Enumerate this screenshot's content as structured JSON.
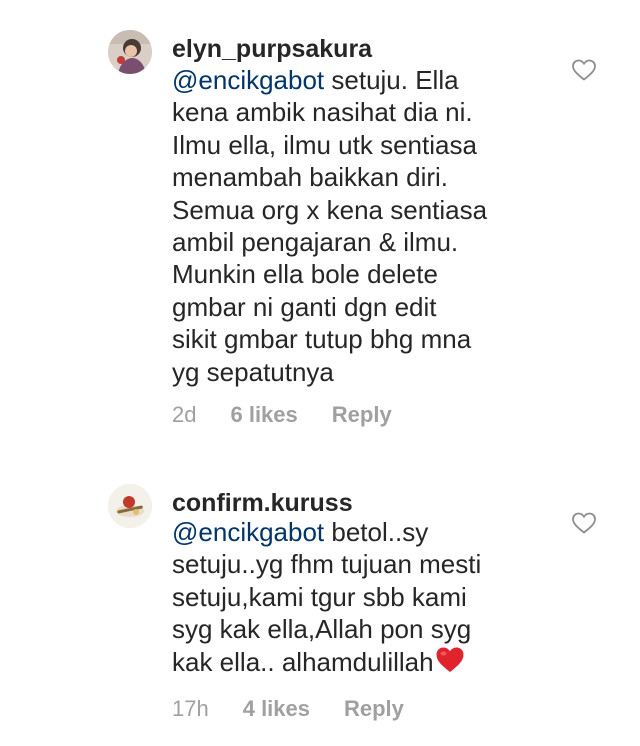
{
  "comments": [
    {
      "username": "elyn_purpsakura",
      "mention": "@encikgabot",
      "text": " setuju.  Ella\nkena ambik nasihat dia ni.\nIlmu ella,  ilmu utk sentiasa\nmenambah baikkan diri.\nSemua org x kena sentiasa\nambil pengajaran & ilmu.\nMunkin ella bole delete\ngmbar ni ganti dgn edit\nsikit gmbar tutup bhg mna\nyg sepatutnya",
      "time": "2d",
      "likes": "6 likes",
      "reply": "Reply",
      "like_icon": "heart-outline-icon",
      "trailing_emoji": ""
    },
    {
      "username": "confirm.kuruss",
      "mention": "@encikgabot",
      "text": " betol..sy\nsetuju..yg fhm tujuan mesti\nsetuju,kami tgur sbb kami\nsyg kak ella,Allah pon syg\nkak ella.. alhamdulillah",
      "time": "17h",
      "likes": "4 likes",
      "reply": "Reply",
      "like_icon": "heart-outline-icon",
      "trailing_emoji": "red-heart-emoji"
    }
  ],
  "colors": {
    "text": "#262626",
    "mention": "#003569",
    "meta": "#a0a0a0",
    "heart_outline": "#8e8e8e",
    "heart_emoji": "#e0242c"
  }
}
